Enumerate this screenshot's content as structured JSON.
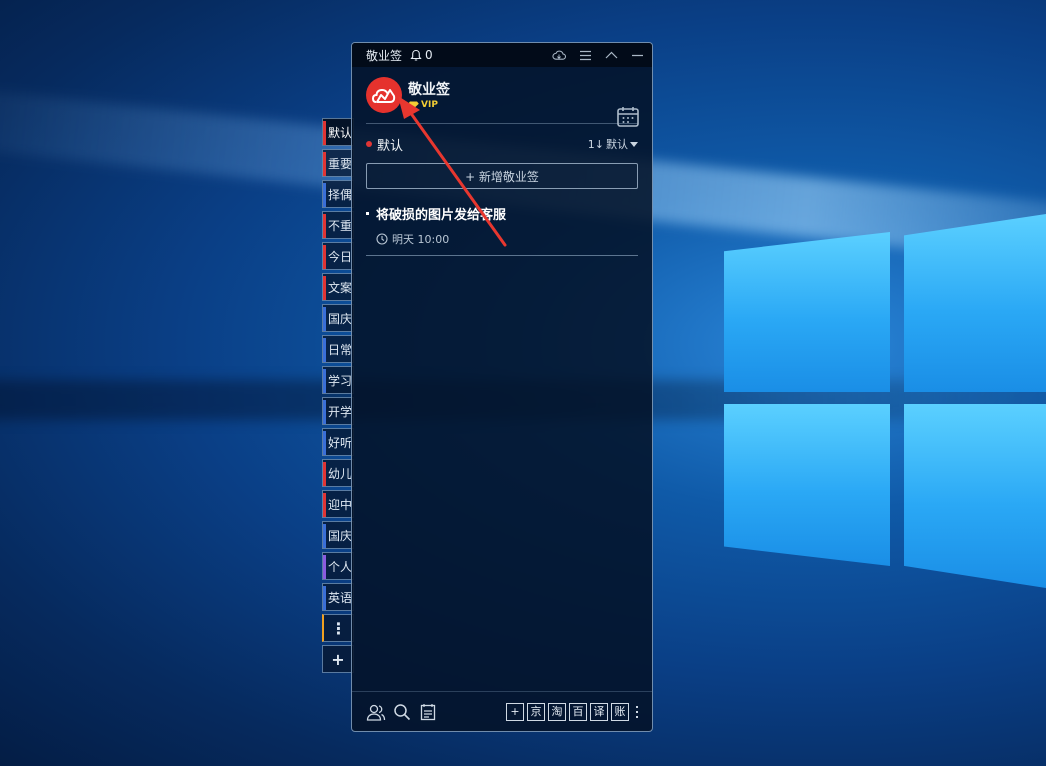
{
  "window": {
    "title": "敬业签",
    "notification_count": "0"
  },
  "profile": {
    "username": "敬业签",
    "badge": "VIP"
  },
  "group": {
    "name": "默认",
    "sort_label": "默认",
    "sort_prefix": "1↓"
  },
  "add_note_label": "+ 新增敬业签",
  "notes": [
    {
      "title": "将破损的图片发给客服",
      "time": "明天 10:00"
    }
  ],
  "side_tabs": [
    {
      "label": "默认",
      "color": "#e03535",
      "active": true
    },
    {
      "label": "重要",
      "color": "#e03535"
    },
    {
      "label": "择偶",
      "color": "#3a6fd8"
    },
    {
      "label": "不重",
      "color": "#e03535"
    },
    {
      "label": "今日",
      "color": "#e03535"
    },
    {
      "label": "文案",
      "color": "#e03535"
    },
    {
      "label": "国庆",
      "color": "#3a6fd8"
    },
    {
      "label": "日常",
      "color": "#3a6fd8"
    },
    {
      "label": "学习",
      "color": "#3a6fd8"
    },
    {
      "label": "开学",
      "color": "#3a6fd8"
    },
    {
      "label": "好听",
      "color": "#3a6fd8"
    },
    {
      "label": "幼儿",
      "color": "#e03535"
    },
    {
      "label": "迎中",
      "color": "#e03535"
    },
    {
      "label": "国庆",
      "color": "#3a6fd8"
    },
    {
      "label": "个人",
      "color": "#8a5be0"
    },
    {
      "label": "英语",
      "color": "#3a6fd8"
    }
  ],
  "side_more_label": "⋮",
  "side_add_label": "+",
  "bottom_tools": [
    "+",
    "京",
    "淘",
    "百",
    "译",
    "账"
  ],
  "colors": {
    "accent_red": "#e5322d",
    "vip_gold": "#f3cd35",
    "annotation_arrow": "#e8372f"
  },
  "icons": [
    "bell-icon",
    "cloud-sync-icon",
    "menu-icon",
    "collapse-icon",
    "minimize-icon",
    "calendar-icon",
    "clock-icon",
    "contacts-icon",
    "search-icon",
    "note-list-icon",
    "more-icon"
  ]
}
